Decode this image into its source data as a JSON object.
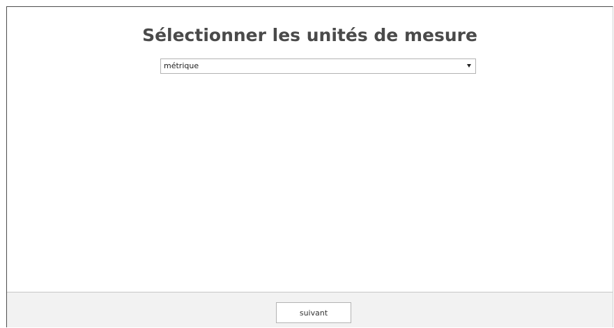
{
  "page": {
    "title": "Sélectionner les unités de mesure"
  },
  "units_select": {
    "selected_value": "métrique"
  },
  "footer": {
    "next_label": "suivant"
  }
}
